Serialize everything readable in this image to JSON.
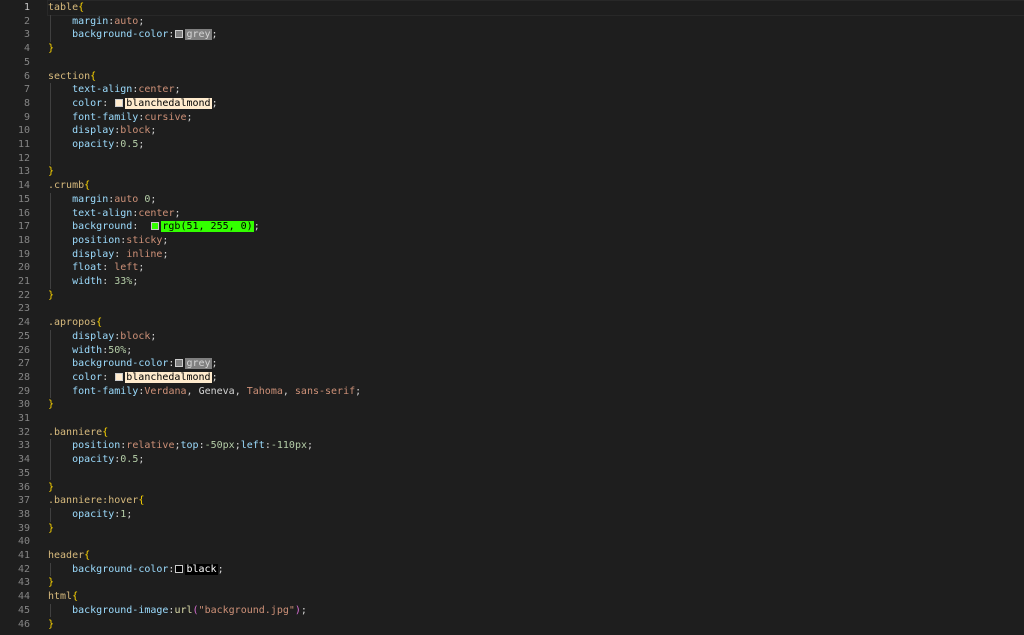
{
  "editor": {
    "active_line": 1,
    "lines": [
      {
        "n": "1",
        "t": [
          [
            "table",
            "sel"
          ],
          [
            "{",
            "brace"
          ]
        ]
      },
      {
        "n": "2",
        "t": [
          [
            "    ",
            ""
          ],
          [
            "margin",
            "prop"
          ],
          [
            ":",
            "punc"
          ],
          [
            "auto",
            "val"
          ],
          [
            ";",
            "punc"
          ]
        ]
      },
      {
        "n": "3",
        "t": [
          [
            "    ",
            ""
          ],
          [
            "background-color",
            "prop"
          ],
          [
            ":",
            "punc"
          ],
          [
            "grey",
            "color",
            "#808080",
            "#808080",
            "#d4d4d4"
          ],
          [
            ";",
            "punc"
          ]
        ]
      },
      {
        "n": "4",
        "t": [
          [
            "}",
            "brace"
          ]
        ]
      },
      {
        "n": "5",
        "t": []
      },
      {
        "n": "6",
        "t": [
          [
            "section",
            "sel"
          ],
          [
            "{",
            "brace"
          ]
        ]
      },
      {
        "n": "7",
        "t": [
          [
            "    ",
            ""
          ],
          [
            "text-align",
            "prop"
          ],
          [
            ":",
            "punc"
          ],
          [
            "center",
            "val"
          ],
          [
            ";",
            "punc"
          ]
        ]
      },
      {
        "n": "8",
        "t": [
          [
            "    ",
            ""
          ],
          [
            "color",
            "prop"
          ],
          [
            ":",
            "punc"
          ],
          [
            " ",
            ""
          ],
          [
            "blanchedalmond",
            "color",
            "#ffebcd",
            "#ffebcd",
            "#000000"
          ],
          [
            ";",
            "punc"
          ]
        ]
      },
      {
        "n": "9",
        "t": [
          [
            "    ",
            ""
          ],
          [
            "font-family",
            "prop"
          ],
          [
            ":",
            "punc"
          ],
          [
            "cursive",
            "val"
          ],
          [
            ";",
            "punc"
          ]
        ]
      },
      {
        "n": "10",
        "t": [
          [
            "    ",
            ""
          ],
          [
            "display",
            "prop"
          ],
          [
            ":",
            "punc"
          ],
          [
            "block",
            "val"
          ],
          [
            ";",
            "punc"
          ]
        ]
      },
      {
        "n": "11",
        "t": [
          [
            "    ",
            ""
          ],
          [
            "opacity",
            "prop"
          ],
          [
            ":",
            "punc"
          ],
          [
            "0.5",
            "num"
          ],
          [
            ";",
            "punc"
          ]
        ]
      },
      {
        "n": "12",
        "t": []
      },
      {
        "n": "13",
        "t": [
          [
            "}",
            "brace"
          ]
        ]
      },
      {
        "n": "14",
        "t": [
          [
            ".crumb",
            "sel"
          ],
          [
            "{",
            "brace"
          ]
        ]
      },
      {
        "n": "15",
        "t": [
          [
            "    ",
            ""
          ],
          [
            "margin",
            "prop"
          ],
          [
            ":",
            "punc"
          ],
          [
            "auto",
            "val"
          ],
          [
            " ",
            ""
          ],
          [
            "0",
            "num"
          ],
          [
            ";",
            "punc"
          ]
        ]
      },
      {
        "n": "16",
        "t": [
          [
            "    ",
            ""
          ],
          [
            "text-align",
            "prop"
          ],
          [
            ":",
            "punc"
          ],
          [
            "center",
            "val"
          ],
          [
            ";",
            "punc"
          ]
        ]
      },
      {
        "n": "17",
        "t": [
          [
            "    ",
            ""
          ],
          [
            "background",
            "prop"
          ],
          [
            ":",
            "punc"
          ],
          [
            "  ",
            ""
          ],
          [
            "rgb(51, 255, 0)",
            "color",
            "#33ff00",
            "#33ff00",
            "#000000"
          ],
          [
            ";",
            "punc"
          ]
        ]
      },
      {
        "n": "18",
        "t": [
          [
            "    ",
            ""
          ],
          [
            "position",
            "prop"
          ],
          [
            ":",
            "punc"
          ],
          [
            "sticky",
            "val"
          ],
          [
            ";",
            "punc"
          ]
        ]
      },
      {
        "n": "19",
        "t": [
          [
            "    ",
            ""
          ],
          [
            "display",
            "prop"
          ],
          [
            ":",
            "punc"
          ],
          [
            " ",
            ""
          ],
          [
            "inline",
            "val"
          ],
          [
            ";",
            "punc"
          ]
        ]
      },
      {
        "n": "20",
        "t": [
          [
            "    ",
            ""
          ],
          [
            "float",
            "prop"
          ],
          [
            ":",
            "punc"
          ],
          [
            " ",
            ""
          ],
          [
            "left",
            "val"
          ],
          [
            ";",
            "punc"
          ]
        ]
      },
      {
        "n": "21",
        "t": [
          [
            "    ",
            ""
          ],
          [
            "width",
            "prop"
          ],
          [
            ":",
            "punc"
          ],
          [
            " ",
            ""
          ],
          [
            "33%",
            "num"
          ],
          [
            ";",
            "punc"
          ]
        ]
      },
      {
        "n": "22",
        "t": [
          [
            "}",
            "brace"
          ]
        ]
      },
      {
        "n": "23",
        "t": []
      },
      {
        "n": "24",
        "t": [
          [
            ".apropos",
            "sel"
          ],
          [
            "{",
            "brace"
          ]
        ]
      },
      {
        "n": "25",
        "t": [
          [
            "    ",
            ""
          ],
          [
            "display",
            "prop"
          ],
          [
            ":",
            "punc"
          ],
          [
            "block",
            "val"
          ],
          [
            ";",
            "punc"
          ]
        ]
      },
      {
        "n": "26",
        "t": [
          [
            "    ",
            ""
          ],
          [
            "width",
            "prop"
          ],
          [
            ":",
            "punc"
          ],
          [
            "50%",
            "num"
          ],
          [
            ";",
            "punc"
          ]
        ]
      },
      {
        "n": "27",
        "t": [
          [
            "    ",
            ""
          ],
          [
            "background-color",
            "prop"
          ],
          [
            ":",
            "punc"
          ],
          [
            "grey",
            "color",
            "#808080",
            "#808080",
            "#d4d4d4"
          ],
          [
            ";",
            "punc"
          ]
        ]
      },
      {
        "n": "28",
        "t": [
          [
            "    ",
            ""
          ],
          [
            "color",
            "prop"
          ],
          [
            ":",
            "punc"
          ],
          [
            " ",
            ""
          ],
          [
            "blanchedalmond",
            "color",
            "#ffebcd",
            "#ffebcd",
            "#000000"
          ],
          [
            ";",
            "punc"
          ]
        ]
      },
      {
        "n": "29",
        "t": [
          [
            "    ",
            ""
          ],
          [
            "font-family",
            "prop"
          ],
          [
            ":",
            "punc"
          ],
          [
            "Verdana",
            "val"
          ],
          [
            ", ",
            "punc"
          ],
          [
            "Geneva",
            "punc"
          ],
          [
            ", ",
            "punc"
          ],
          [
            "Tahoma",
            "val"
          ],
          [
            ", ",
            "punc"
          ],
          [
            "sans-serif",
            "val"
          ],
          [
            ";",
            "punc"
          ]
        ]
      },
      {
        "n": "30",
        "t": [
          [
            "}",
            "brace"
          ]
        ]
      },
      {
        "n": "31",
        "t": []
      },
      {
        "n": "32",
        "t": [
          [
            ".banniere",
            "sel"
          ],
          [
            "{",
            "brace"
          ]
        ]
      },
      {
        "n": "33",
        "t": [
          [
            "    ",
            ""
          ],
          [
            "position",
            "prop"
          ],
          [
            ":",
            "punc"
          ],
          [
            "relative",
            "val"
          ],
          [
            ";",
            "punc"
          ],
          [
            "top",
            "prop"
          ],
          [
            ":",
            "punc"
          ],
          [
            "-50px",
            "num"
          ],
          [
            ";",
            "punc"
          ],
          [
            "left",
            "prop"
          ],
          [
            ":",
            "punc"
          ],
          [
            "-110px",
            "num"
          ],
          [
            ";",
            "punc"
          ]
        ]
      },
      {
        "n": "34",
        "t": [
          [
            "    ",
            ""
          ],
          [
            "opacity",
            "prop"
          ],
          [
            ":",
            "punc"
          ],
          [
            "0.5",
            "num"
          ],
          [
            ";",
            "punc"
          ]
        ]
      },
      {
        "n": "35",
        "t": []
      },
      {
        "n": "36",
        "t": [
          [
            "}",
            "brace"
          ]
        ]
      },
      {
        "n": "37",
        "t": [
          [
            ".banniere:hover",
            "sel"
          ],
          [
            "{",
            "brace"
          ]
        ]
      },
      {
        "n": "38",
        "t": [
          [
            "    ",
            ""
          ],
          [
            "opacity",
            "prop"
          ],
          [
            ":",
            "punc"
          ],
          [
            "1",
            "num"
          ],
          [
            ";",
            "punc"
          ]
        ]
      },
      {
        "n": "39",
        "t": [
          [
            "}",
            "brace"
          ]
        ]
      },
      {
        "n": "40",
        "t": []
      },
      {
        "n": "41",
        "t": [
          [
            "header",
            "sel"
          ],
          [
            "{",
            "brace"
          ]
        ]
      },
      {
        "n": "42",
        "t": [
          [
            "    ",
            ""
          ],
          [
            "background-color",
            "prop"
          ],
          [
            ":",
            "punc"
          ],
          [
            "black",
            "color",
            "#000000",
            "#000000",
            "#ffffff"
          ],
          [
            ";",
            "punc"
          ]
        ]
      },
      {
        "n": "43",
        "t": [
          [
            "}",
            "brace"
          ]
        ]
      },
      {
        "n": "44",
        "t": [
          [
            "html",
            "sel"
          ],
          [
            "{",
            "brace"
          ]
        ]
      },
      {
        "n": "45",
        "t": [
          [
            "    ",
            ""
          ],
          [
            "background-image",
            "prop"
          ],
          [
            ":",
            "punc"
          ],
          [
            "url",
            "fn"
          ],
          [
            "(",
            "paren"
          ],
          [
            "\"background.jpg\"",
            "str"
          ],
          [
            ")",
            "paren"
          ],
          [
            ";",
            "punc"
          ]
        ]
      },
      {
        "n": "46",
        "t": [
          [
            "}",
            "brace"
          ]
        ]
      }
    ]
  },
  "theme": {
    "background": "#1e1e1e",
    "selector": "#d7ba7d",
    "property": "#9cdcfe",
    "value": "#ce9178",
    "number": "#b5cea8",
    "brace": "#ffd700",
    "function": "#dcdcaa",
    "paren": "#da70d6",
    "line_number": "#858585",
    "line_number_active": "#c6c6c6"
  }
}
